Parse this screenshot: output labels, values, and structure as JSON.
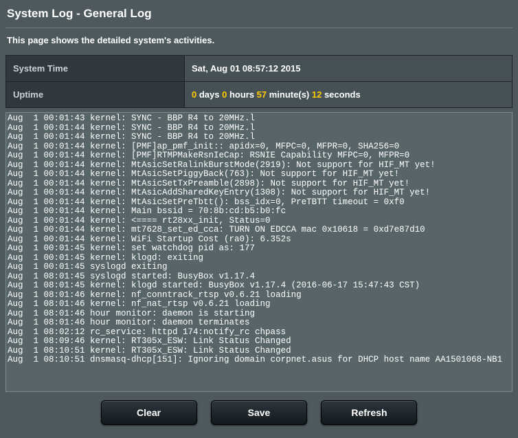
{
  "title": "System Log - General Log",
  "description": "This page shows the detailed system's activities.",
  "info": {
    "system_time_label": "System Time",
    "system_time_value": "Sat, Aug 01 08:57:12 2015",
    "uptime_label": "Uptime",
    "uptime_parts": {
      "days_n": "0",
      "days_t": " days ",
      "hours_n": "0",
      "hours_t": " hours ",
      "mins_n": "57",
      "mins_t": " minute(s) ",
      "secs_n": "12",
      "secs_t": " seconds"
    }
  },
  "log_text": "Aug  1 00:01:43 kernel: SYNC - BBP R4 to 20MHz.l\nAug  1 00:01:44 kernel: SYNC - BBP R4 to 20MHz.l\nAug  1 00:01:44 kernel: SYNC - BBP R4 to 20MHz.l\nAug  1 00:01:44 kernel: [PMF]ap_pmf_init:: apidx=0, MFPC=0, MFPR=0, SHA256=0\nAug  1 00:01:44 kernel: [PMF]RTMPMakeRsnIeCap: RSNIE Capability MFPC=0, MFPR=0\nAug  1 00:01:44 kernel: MtAsicSetRalinkBurstMode(2919): Not support for HIF_MT yet!\nAug  1 00:01:44 kernel: MtAsicSetPiggyBack(763): Not support for HIF_MT yet!\nAug  1 00:01:44 kernel: MtAsicSetTxPreamble(2898): Not support for HIF_MT yet!\nAug  1 00:01:44 kernel: MtAsicAddSharedKeyEntry(1308): Not support for HIF_MT yet!\nAug  1 00:01:44 kernel: MtAsicSetPreTbtt(): bss_idx=0, PreTBTT timeout = 0xf0\nAug  1 00:01:44 kernel: Main bssid = 70:8b:cd:b5:b0:fc\nAug  1 00:01:44 kernel: <==== rt28xx_init, Status=0\nAug  1 00:01:44 kernel: mt7628_set_ed_cca: TURN ON EDCCA mac 0x10618 = 0xd7e87d10\nAug  1 00:01:44 kernel: WiFi Startup Cost (ra0): 6.352s\nAug  1 00:01:45 kernel: set watchdog pid as: 177\nAug  1 00:01:45 kernel: klogd: exiting\nAug  1 00:01:45 syslogd exiting\nAug  1 08:01:45 syslogd started: BusyBox v1.17.4\nAug  1 08:01:45 kernel: klogd started: BusyBox v1.17.4 (2016-06-17 15:47:43 CST)\nAug  1 08:01:46 kernel: nf_conntrack_rtsp v0.6.21 loading\nAug  1 08:01:46 kernel: nf_nat_rtsp v0.6.21 loading\nAug  1 08:01:46 hour monitor: daemon is starting\nAug  1 08:01:46 hour monitor: daemon terminates\nAug  1 08:02:12 rc_service: httpd 174:notify_rc chpass\nAug  1 08:09:46 kernel: RT305x_ESW: Link Status Changed\nAug  1 08:10:51 kernel: RT305x_ESW: Link Status Changed\nAug  1 08:10:51 dnsmasq-dhcp[151]: Ignoring domain corpnet.asus for DHCP host name AA1501068-NB1",
  "buttons": {
    "clear": "Clear",
    "save": "Save",
    "refresh": "Refresh"
  }
}
